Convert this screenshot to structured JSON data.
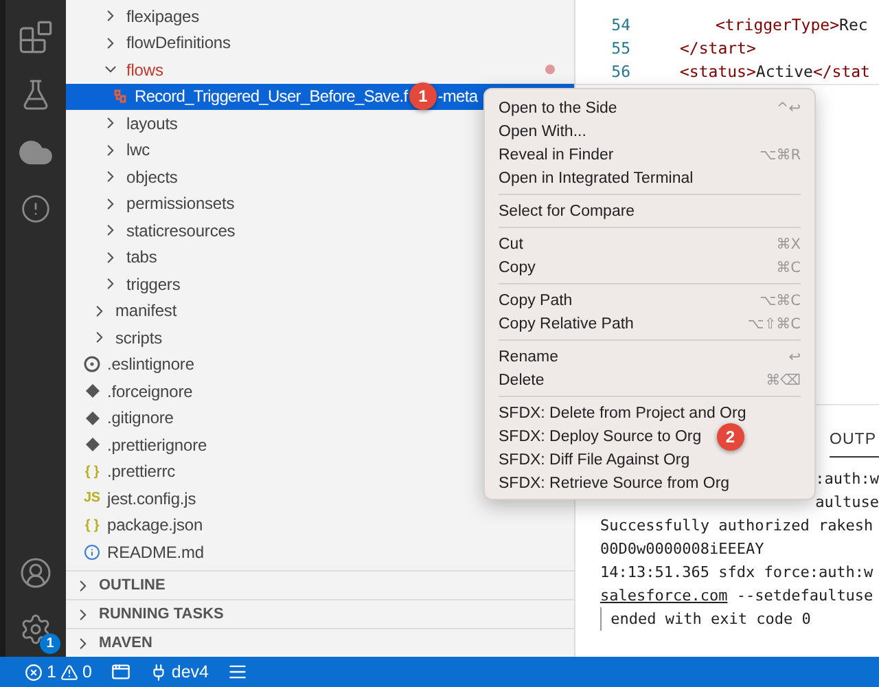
{
  "activity_bar": {
    "settings_badge": "1"
  },
  "explorer": {
    "inner_items": [
      {
        "label": "flexipages",
        "kind": "folder",
        "expanded": false,
        "modified": false,
        "selected": false
      },
      {
        "label": "flowDefinitions",
        "kind": "folder",
        "expanded": false,
        "modified": false,
        "selected": false
      },
      {
        "label": "flows",
        "kind": "folder",
        "expanded": true,
        "modified": true,
        "selected": false,
        "children": [
          {
            "label": "Record_Triggered_User_Before_Save.f",
            "label_tail": "-meta",
            "kind": "flow",
            "selected": true,
            "badge": "1"
          }
        ]
      },
      {
        "label": "layouts",
        "kind": "folder",
        "expanded": false,
        "modified": false,
        "selected": false
      },
      {
        "label": "lwc",
        "kind": "folder",
        "expanded": false,
        "modified": false,
        "selected": false
      },
      {
        "label": "objects",
        "kind": "folder",
        "expanded": false,
        "modified": false,
        "selected": false
      },
      {
        "label": "permissionsets",
        "kind": "folder",
        "expanded": false,
        "modified": false,
        "selected": false
      },
      {
        "label": "staticresources",
        "kind": "folder",
        "expanded": false,
        "modified": false,
        "selected": false
      },
      {
        "label": "tabs",
        "kind": "folder",
        "expanded": false,
        "modified": false,
        "selected": false
      },
      {
        "label": "triggers",
        "kind": "folder",
        "expanded": false,
        "modified": false,
        "selected": false
      }
    ],
    "items": [
      {
        "label": "manifest",
        "kind": "folder",
        "expanded": false,
        "modified": false,
        "selected": false
      },
      {
        "label": "scripts",
        "kind": "folder",
        "expanded": false,
        "modified": false,
        "selected": false
      },
      {
        "label": ".eslintignore",
        "kind": "eslint",
        "selected": false
      },
      {
        "label": ".forceignore",
        "kind": "git",
        "selected": false
      },
      {
        "label": ".gitignore",
        "kind": "git",
        "selected": false
      },
      {
        "label": ".prettierignore",
        "kind": "git",
        "selected": false
      },
      {
        "label": ".prettierrc",
        "kind": "json",
        "icon": "{ }",
        "selected": false
      },
      {
        "label": "jest.config.js",
        "kind": "js",
        "icon": "JS",
        "selected": false
      },
      {
        "label": "package.json",
        "kind": "json",
        "icon": "{ }",
        "selected": false
      },
      {
        "label": "README.md",
        "kind": "info",
        "selected": false
      }
    ]
  },
  "sections": [
    {
      "title": "OUTLINE",
      "expanded": false
    },
    {
      "title": "RUNNING TASKS",
      "expanded": false
    },
    {
      "title": "MAVEN",
      "expanded": false
    }
  ],
  "editor": {
    "lines": [
      {
        "number": "54",
        "kind": "inner",
        "tokens": [
          {
            "text": "<triggerType>",
            "kind": "tag"
          },
          {
            "text": "Rec",
            "kind": "text"
          }
        ]
      },
      {
        "number": "55",
        "kind": "outer",
        "tokens": [
          {
            "text": "</start>",
            "kind": "tag"
          }
        ]
      },
      {
        "number": "56",
        "kind": "outer",
        "tokens": [
          {
            "text": "<status>",
            "kind": "tag"
          },
          {
            "text": "Active",
            "kind": "text"
          },
          {
            "text": "</stat",
            "kind": "tag"
          }
        ]
      }
    ]
  },
  "panel": {
    "tab": "OUTP",
    "lines": [
      {
        "text": ":auth:w",
        "kind": "partial"
      },
      {
        "text": "aultuse",
        "kind": "partial"
      },
      {
        "text": "Successfully authorized rakesh",
        "kind": "plain"
      },
      {
        "text": "00D0w0000008iEEEAY",
        "kind": "plain"
      },
      {
        "text": "14:13:51.365 sfdx force:auth:w",
        "kind": "plain"
      },
      {
        "text": "salesforce.com",
        "rest": " --setdefaultuse",
        "kind": "link"
      },
      {
        "text": " ended with exit code 0",
        "kind": "marked"
      }
    ]
  },
  "context_menu": {
    "groups": [
      {
        "items": [
          {
            "label": "Open to the Side",
            "shortcut": "^↩"
          },
          {
            "label": "Open With..."
          },
          {
            "label": "Reveal in Finder",
            "shortcut": "⌥⌘R"
          },
          {
            "label": "Open in Integrated Terminal"
          }
        ]
      },
      {
        "items": [
          {
            "label": "Select for Compare"
          }
        ]
      },
      {
        "items": [
          {
            "label": "Cut",
            "shortcut": "⌘X"
          },
          {
            "label": "Copy",
            "shortcut": "⌘C"
          }
        ]
      },
      {
        "items": [
          {
            "label": "Copy Path",
            "shortcut": "⌥⌘C"
          },
          {
            "label": "Copy Relative Path",
            "shortcut": "⌥⇧⌘C"
          }
        ]
      },
      {
        "items": [
          {
            "label": "Rename",
            "shortcut": "↩"
          },
          {
            "label": "Delete",
            "shortcut": "⌘⌫"
          }
        ]
      },
      {
        "items": [
          {
            "label": "SFDX: Delete from Project and Org"
          },
          {
            "label": "SFDX: Deploy Source to Org",
            "badge": "2"
          },
          {
            "label": "SFDX: Diff File Against Org"
          },
          {
            "label": "SFDX: Retrieve Source from Org"
          }
        ]
      }
    ]
  },
  "status_bar": {
    "errors": "1",
    "warnings": "0",
    "org": "dev4"
  }
}
